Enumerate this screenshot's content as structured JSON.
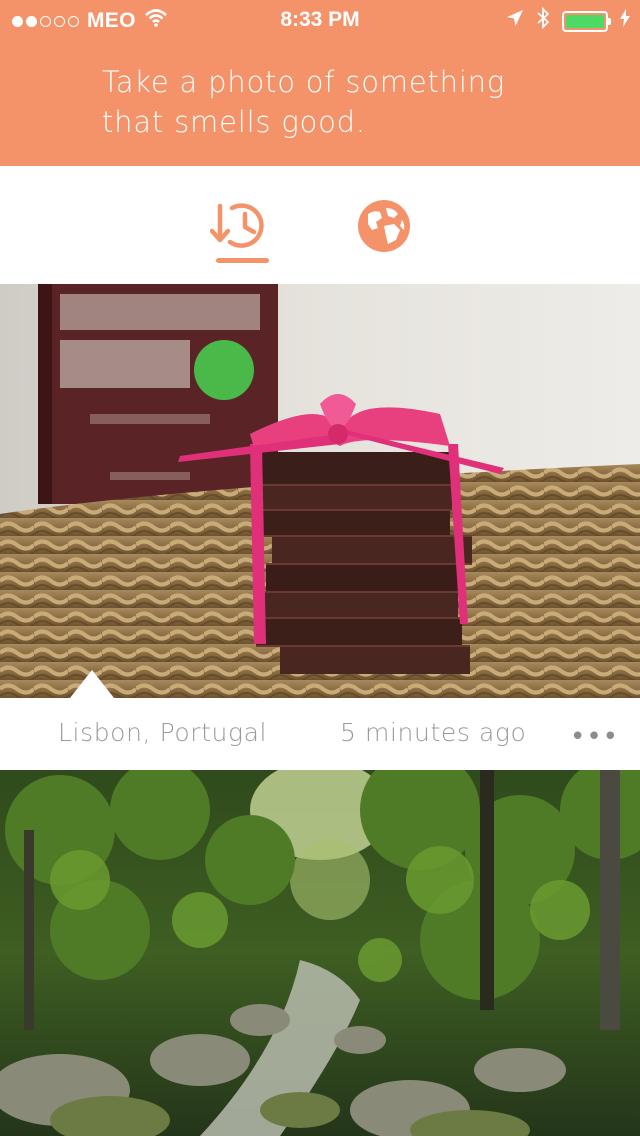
{
  "status_bar": {
    "carrier": "MEO",
    "time": "8:33 PM",
    "signal_dots_filled": 2,
    "signal_dots_total": 5
  },
  "header": {
    "prompt_line1": "Take a photo of something",
    "prompt_line2": "that smells good."
  },
  "tabs": [
    {
      "name": "recent",
      "icon": "history-download-icon",
      "selected": true
    },
    {
      "name": "world",
      "icon": "globe-icon",
      "selected": false
    }
  ],
  "feed": [
    {
      "photo": "chocolate-stack-photo",
      "location": "Lisbon, Portugal",
      "time_ago": "5 minutes ago",
      "more_label": "•••"
    },
    {
      "photo": "forest-stream-photo"
    }
  ],
  "colors": {
    "accent": "#f4936a",
    "meta_text": "#9a9a9a",
    "battery": "#4cd964"
  }
}
